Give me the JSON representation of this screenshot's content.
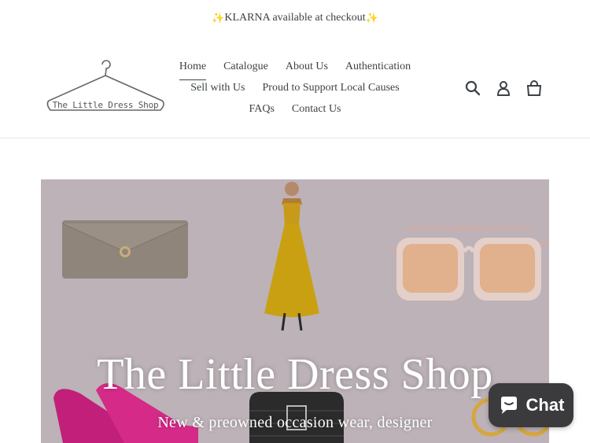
{
  "announcement": {
    "sparkle_left": "✨",
    "text": "KLARNA available at checkout",
    "sparkle_right": "✨"
  },
  "logo": {
    "text": "The Little Dress Shop"
  },
  "nav": {
    "row1": [
      "Home",
      "Catalogue",
      "About Us",
      "Authentication"
    ],
    "row2": [
      "Sell with Us",
      "Proud to Support Local Causes"
    ],
    "row3": [
      "FAQs",
      "Contact Us"
    ],
    "active": "Home"
  },
  "header_icons": [
    "search-icon",
    "account-icon",
    "cart-icon"
  ],
  "hero": {
    "title": "The Little Dress Shop",
    "subtitle": "New & preowned occasion wear, designer"
  },
  "chat": {
    "label": "Chat",
    "icon": "chat-bubble-icon"
  },
  "colors": {
    "hero_bg": "#bcb2b8",
    "text": "#3d4246",
    "chat_bg": "#3b3b3d"
  }
}
